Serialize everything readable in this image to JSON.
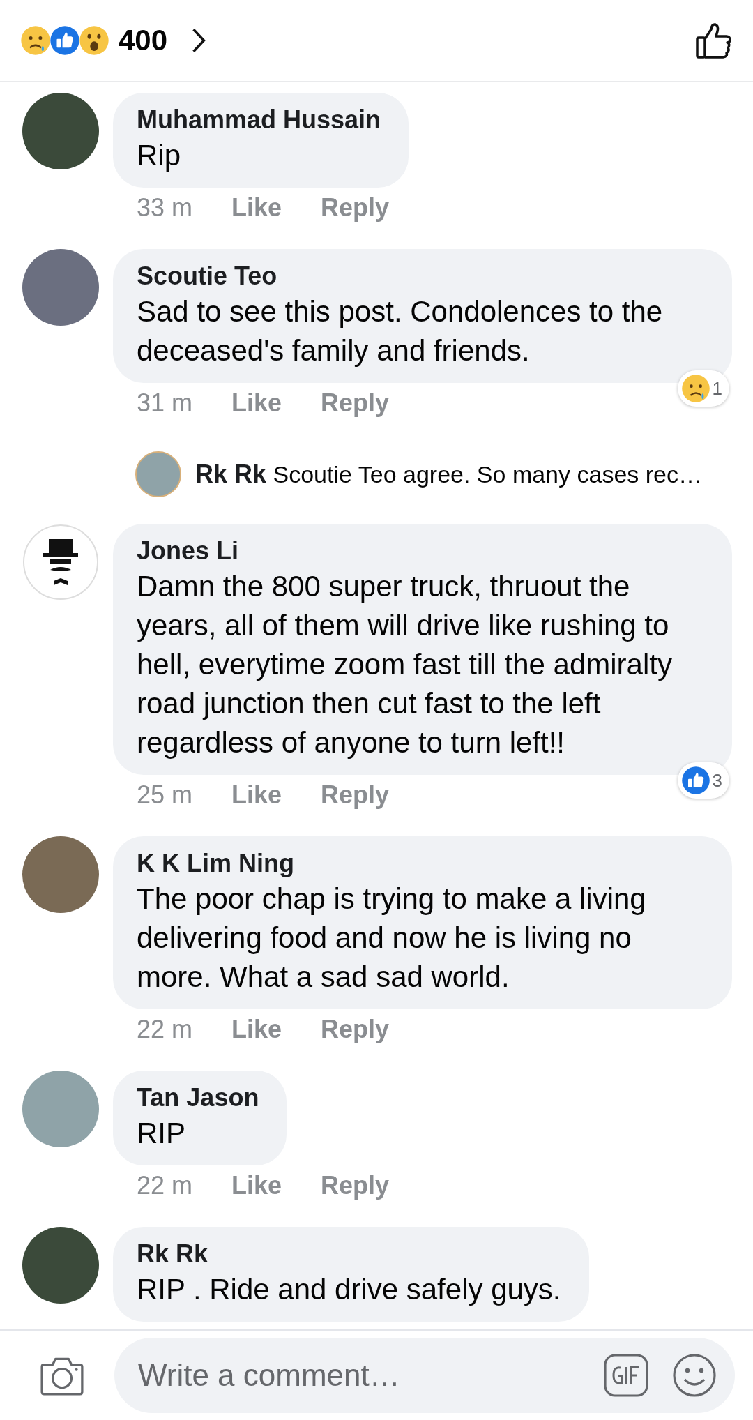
{
  "reactions_summary": {
    "emojis": [
      {
        "kind": "sad"
      },
      {
        "kind": "like"
      },
      {
        "kind": "wow"
      }
    ],
    "count": "400"
  },
  "comments": [
    {
      "avatar": {
        "kind": "photo"
      },
      "name": "Muhammad Hussain",
      "text": "Rip",
      "time": "33 m",
      "like": "Like",
      "reply": "Reply"
    },
    {
      "avatar": {
        "kind": "photo"
      },
      "name": "Scoutie Teo",
      "text": "Sad to see this post. Condolences to the deceased's family and friends.",
      "time": "31 m",
      "like": "Like",
      "reply": "Reply",
      "reaction": {
        "kind": "sad",
        "count": "1"
      },
      "reply_preview": {
        "name": "Rk Rk",
        "text": "Scoutie Teo agree. So many cases rec…"
      }
    },
    {
      "avatar": {
        "kind": "drawing"
      },
      "name": "Jones Li",
      "text": "Damn the 800 super truck, thruout the years, all of them will drive like rushing to hell, everytime zoom fast till the admiralty road junction then cut fast to the left regardless of anyone to turn left!!",
      "time": "25 m",
      "like": "Like",
      "reply": "Reply",
      "reaction": {
        "kind": "like",
        "count": "3"
      }
    },
    {
      "avatar": {
        "kind": "photo"
      },
      "name": "K K Lim Ning",
      "text": "The poor chap is trying to make a living delivering food and now he is living no more. What a sad sad world.",
      "time": "22 m",
      "like": "Like",
      "reply": "Reply"
    },
    {
      "avatar": {
        "kind": "photo"
      },
      "name": "Tan Jason",
      "text": "RIP",
      "time": "22 m",
      "like": "Like",
      "reply": "Reply"
    },
    {
      "avatar": {
        "kind": "photo"
      },
      "name": "Rk Rk",
      "text": "RIP . Ride and drive safely guys."
    }
  ],
  "composer": {
    "placeholder": "Write a comment…"
  }
}
